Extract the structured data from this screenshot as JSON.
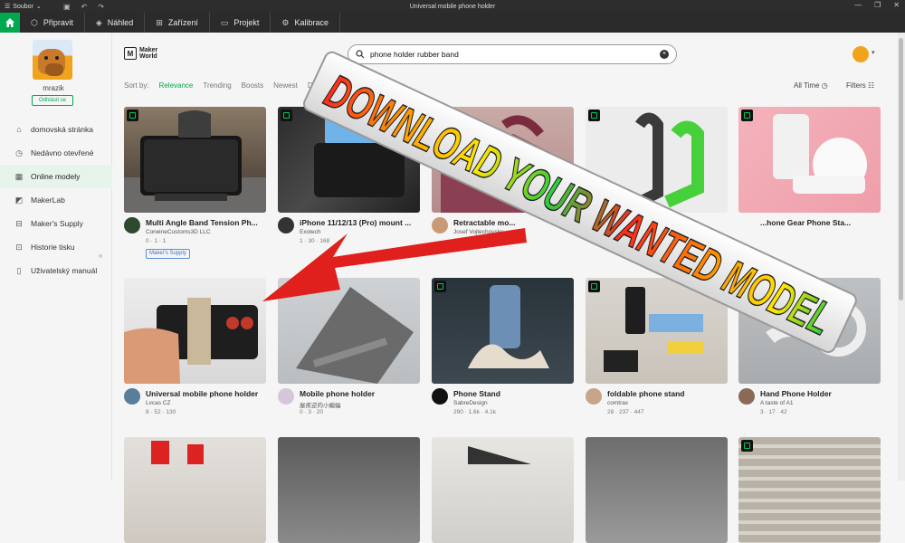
{
  "titlebar": {
    "menu_label": "Soubor",
    "title": "Universal mobile phone holder"
  },
  "tabs": [
    {
      "label": "Připravit",
      "icon": "cube-icon"
    },
    {
      "label": "Náhled",
      "icon": "layers-icon"
    },
    {
      "label": "Zařízení",
      "icon": "device-icon"
    },
    {
      "label": "Projekt",
      "icon": "folder-icon"
    },
    {
      "label": "Kalibrace",
      "icon": "gear-icon"
    }
  ],
  "sidebar": {
    "username": "mrazik",
    "logout_label": "Odhlásit se",
    "items": [
      {
        "label": "domovská stránka",
        "icon": "home-icon"
      },
      {
        "label": "Nedávno otevřené",
        "icon": "clock-icon"
      },
      {
        "label": "Online modely",
        "icon": "online-icon"
      },
      {
        "label": "MakerLab",
        "icon": "makerlab-icon"
      },
      {
        "label": "Maker's Supply",
        "icon": "box-icon"
      },
      {
        "label": "Historie tisku",
        "icon": "history-icon"
      },
      {
        "label": "Uživatelský manuál",
        "icon": "manual-icon"
      }
    ]
  },
  "logo": {
    "line1": "Maker",
    "line2": "World"
  },
  "search": {
    "value": "phone holder rubber band"
  },
  "sort": {
    "label": "Sort by:",
    "options": [
      "Relevance",
      "Trending",
      "Boosts",
      "Newest",
      "Downloads",
      "Likes"
    ],
    "active": "Relevance",
    "time": "All Time",
    "filters": "Filters"
  },
  "overlay": {
    "text": "DOWNLOAD YOUR WANTED MODEL"
  },
  "models": [
    {
      "title": "Multi Angle Band Tension Ph...",
      "author": "CorwineCustoms3D LLC",
      "stats": "0 · 1 · 1",
      "supply": "Maker's Supply"
    },
    {
      "title": "iPhone 11/12/13 (Pro) mount ...",
      "author": "Exotech",
      "stats": "1 · 30 · 168"
    },
    {
      "title": "Retractable mo...",
      "author": "Josef Vojtechovsky",
      "stats": "33 · 725 · 824"
    },
    {
      "title": "",
      "author": "",
      "stats": ""
    },
    {
      "title": "...hone Gear Phone Sta...",
      "author": "",
      "stats": ""
    },
    {
      "title": "Universal mobile phone holder",
      "author": "Lvcas CZ",
      "stats": "8 · 52 · 130"
    },
    {
      "title": "Mobile phone holder",
      "author": "屋疾逆的小蝙蝠",
      "stats": "0 · 3 · 20"
    },
    {
      "title": "Phone Stand",
      "author": "SabreDesign",
      "stats": "290 · 1.6k · 4.1k"
    },
    {
      "title": "foldable phone stand",
      "author": "comtrax",
      "stats": "28 · 237 · 447"
    },
    {
      "title": "Hand Phone Holder",
      "author": "A taste of A1",
      "stats": "3 · 17 · 42"
    }
  ],
  "colors": {
    "accent": "#00a84f",
    "titlebar": "#2d2d2d",
    "arrow": "#e0201c"
  }
}
